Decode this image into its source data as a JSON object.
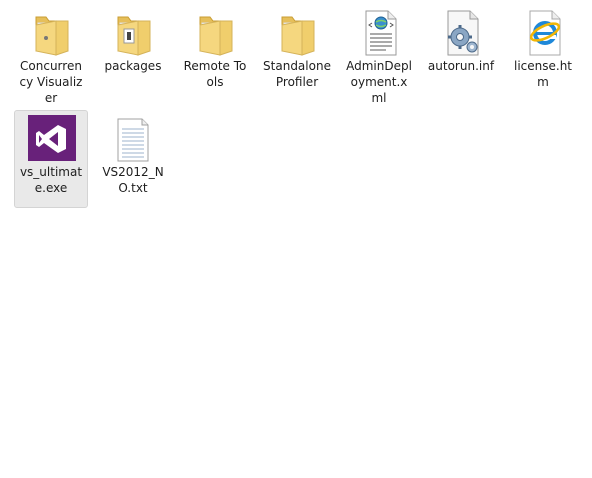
{
  "icon_names": {
    "folder": "folder-icon",
    "xml": "xml-document-icon",
    "config": "config-settings-icon",
    "ie": "internet-explorer-icon",
    "vs": "visual-studio-icon",
    "text": "text-document-icon"
  },
  "items": [
    {
      "label": "Concurrency Visualizer",
      "icon": "folder-icon",
      "selected": false
    },
    {
      "label": "packages",
      "icon": "folder-icon",
      "selected": false
    },
    {
      "label": "Remote Tools",
      "icon": "folder-icon",
      "selected": false
    },
    {
      "label": "Standalone Profiler",
      "icon": "folder-icon",
      "selected": false
    },
    {
      "label": "AdminDeployment.xml",
      "icon": "xml-document-icon",
      "selected": false
    },
    {
      "label": "autorun.inf",
      "icon": "config-settings-icon",
      "selected": false
    },
    {
      "label": "license.htm",
      "icon": "internet-explorer-icon",
      "selected": false
    },
    {
      "label": "vs_ultimate.exe",
      "icon": "visual-studio-icon",
      "selected": true
    },
    {
      "label": "VS2012_NO.txt",
      "icon": "text-document-icon",
      "selected": false
    }
  ],
  "colors": {
    "selection_background": "#e9e9e9",
    "selection_border": "#d4d4d4",
    "folder_yellow": "#f5d77f",
    "vs_purple": "#68217a",
    "ie_blue": "#1e88d9"
  }
}
